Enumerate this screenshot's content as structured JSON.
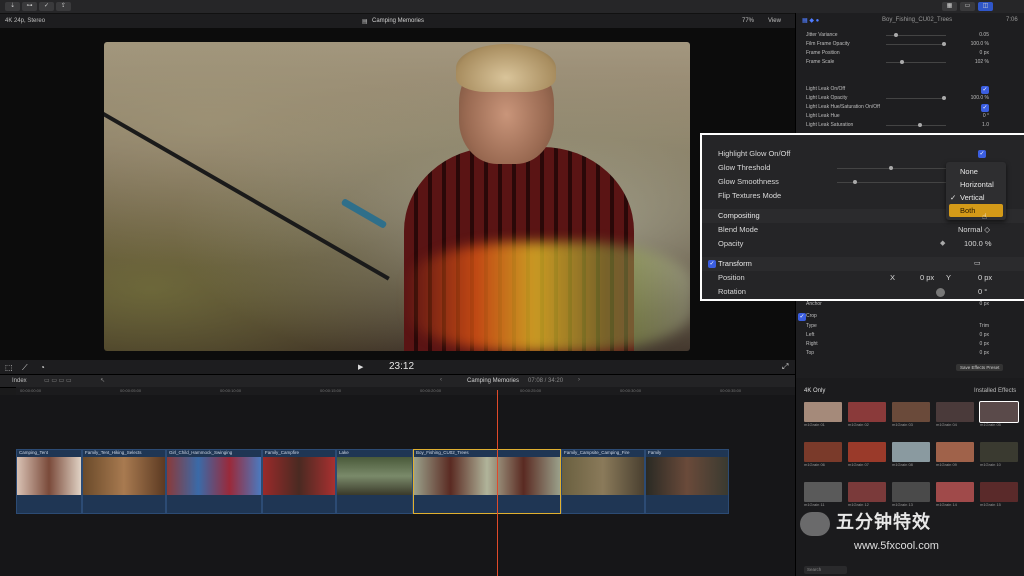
{
  "toolbar": {
    "buttons": [
      "import-icon",
      "keywords-icon",
      "check-icon",
      "share-icon"
    ],
    "right_buttons": [
      "grid-icon",
      "list-icon",
      "inspector-icon"
    ]
  },
  "viewer": {
    "format": "4K 24p, Stereo",
    "title": "Camping Memories",
    "zoom": "77%",
    "view_label": "View",
    "timecode": "23:12"
  },
  "inspector": {
    "clip_name": "Boy_Fishing_CU02_Trees",
    "duration": "7:06",
    "rows": [
      {
        "label": "Jitter Variance",
        "value": "0.05"
      },
      {
        "label": "Film Frame Opacity",
        "value": "100.0  %"
      },
      {
        "label": "Frame Position",
        "value": "0  px"
      },
      {
        "label": "Frame Scale",
        "value": "102  %"
      },
      {
        "label": "Light Leak On/Off",
        "value": ""
      },
      {
        "label": "Light Leak Opacity",
        "value": "100.0  %"
      },
      {
        "label": "Light Leak Hue/Saturation On/Off",
        "value": ""
      },
      {
        "label": "Light Leak Hue",
        "value": "0  °"
      },
      {
        "label": "Light Leak Saturation",
        "value": "1.0"
      }
    ],
    "lower_rows": [
      {
        "label": "Anchor",
        "value": "0  px"
      },
      {
        "label": "Crop",
        "value": ""
      },
      {
        "label": "Type",
        "value": "Trim"
      },
      {
        "label": "Left",
        "value": "0  px"
      },
      {
        "label": "Right",
        "value": "0  px"
      },
      {
        "label": "Top",
        "value": "0  px"
      }
    ],
    "save_button": "Save Effects Preset"
  },
  "popup": {
    "rows": [
      {
        "label": "Highlight Glow On/Off",
        "value": ""
      },
      {
        "label": "Glow Threshold",
        "value": ""
      },
      {
        "label": "Glow Smoothness",
        "value": ""
      },
      {
        "label": "Flip Textures Mode",
        "value": ""
      }
    ],
    "compositing": {
      "label": "Compositing"
    },
    "blend_mode": {
      "label": "Blend Mode",
      "value": "Normal ◇"
    },
    "opacity": {
      "label": "Opacity",
      "value": "100.0  %"
    },
    "transform": {
      "label": "Transform"
    },
    "position": {
      "label": "Position",
      "x_label": "X",
      "x_value": "0  px",
      "y_label": "Y",
      "y_value": "0  px"
    },
    "rotation": {
      "label": "Rotation",
      "value": "0  °"
    },
    "menu": {
      "options": [
        "None",
        "Horizontal",
        "Vertical",
        "Both"
      ],
      "selected": "Vertical",
      "hovered": "Both"
    }
  },
  "timeline": {
    "index_label": "Index",
    "project": "Camping Memories",
    "duration": "07:08 / 34:20",
    "ruler": [
      "00:00:00:00",
      "00:00:05:00",
      "00:00:10:00",
      "00:00:15:00",
      "00:00:20:00",
      "00:00:25:00",
      "00:00:30:00",
      "00:00:35:00"
    ],
    "clips": [
      {
        "name": "Camping_Tent",
        "color": "#c9b4a6"
      },
      {
        "name": "Family_Tent_Hiking_Selects",
        "color": "#8a5a3a"
      },
      {
        "name": "Girl_Child_Hammock_Swinging",
        "color": "#3d5a86"
      },
      {
        "name": "Family_Campfire",
        "color": "#7a2a2a"
      },
      {
        "name": "Lake",
        "color": "#4b5a3a"
      },
      {
        "name": "Boy_Fishing_CU02_Trees",
        "color": "#7f8a6a"
      },
      {
        "name": "Family_Campsite_Camping_Fire",
        "color": "#6b6040"
      },
      {
        "name": "Family",
        "color": "#3a3a30"
      }
    ]
  },
  "browser": {
    "category": "4K Only",
    "filter": "Installed Effects",
    "effects": [
      "m1Grain 01",
      "m1Grain 02",
      "m1Grain 03",
      "m1Grain 04",
      "m1Grain 05",
      "m1Grain 06",
      "m1Grain 07",
      "m1Grain 08",
      "m1Grain 09",
      "m1Grain 10",
      "m1Grain 11",
      "m1Grain 12",
      "m1Grain 13",
      "m1Grain 14",
      "m1Grain 15"
    ],
    "search_placeholder": "Search"
  },
  "watermark": {
    "title": "五分钟特效",
    "url": "www.5fxcool.com"
  }
}
